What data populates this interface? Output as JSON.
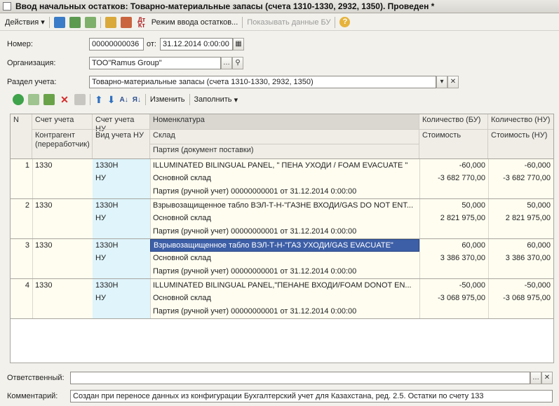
{
  "window": {
    "title": "Ввод начальных остатков: Товарно-материальные запасы (счета 1310-1330, 2932, 1350). Проведен *"
  },
  "toolbar": {
    "actions_label": "Действия",
    "mode_label": "Режим ввода остатков...",
    "show_bu_label": "Показывать данные БУ",
    "help_label": "?"
  },
  "header": {
    "number_label": "Номер:",
    "number_value": "00000000036",
    "date_label": "от:",
    "date_value": "31.12.2014 0:00:00",
    "org_label": "Организация:",
    "org_value": "ТОО\"Ramus Group\"",
    "section_label": "Раздел учета:",
    "section_value": "Товарно-материальные запасы (счета 1310-1330, 2932, 1350)"
  },
  "table_toolbar": {
    "edit_label": "Изменить",
    "fill_label": "Заполнить"
  },
  "table": {
    "headers": {
      "n": "N",
      "account": "Счет учета",
      "account_nu": "Счет учета НУ",
      "nomenclature": "Номенклатура",
      "qty_bu": "Количество (БУ)",
      "qty_nu": "Количество (НУ)",
      "contractor": "Контрагент (переработчик)",
      "type_nu": "Вид учета НУ",
      "warehouse": "Склад",
      "batch": "Партия (документ поставки)",
      "cost_bu": "Стоимость",
      "cost_nu": "Стоимость (НУ)"
    },
    "rows": [
      {
        "n": "1",
        "account": "1330",
        "account_nu": "1330Н",
        "type_nu": "НУ",
        "nomenclature": "ILLUMINATED BILINGUAL PANEL, \" ПЕНА УХОДИ / FOAM EVACUATE \"",
        "warehouse": "Основной склад",
        "batch": "Партия (ручной учет) 00000000001 от 31.12.2014 0:00:00",
        "qty_bu": "-60,000",
        "cost_bu": "-3 682 770,00",
        "qty_nu": "-60,000",
        "cost_nu": "-3 682 770,00"
      },
      {
        "n": "2",
        "account": "1330",
        "account_nu": "1330Н",
        "type_nu": "НУ",
        "nomenclature": "Взрывозащищенное табло ВЭЛ-Т-Н-\"ГАЗНЕ ВХОДИ/GAS DO NOT ENT...",
        "warehouse": "Основной склад",
        "batch": "Партия (ручной учет) 00000000001 от 31.12.2014 0:00:00",
        "qty_bu": "50,000",
        "cost_bu": "2 821 975,00",
        "qty_nu": "50,000",
        "cost_nu": "2 821 975,00"
      },
      {
        "n": "3",
        "account": "1330",
        "account_nu": "1330Н",
        "type_nu": "НУ",
        "nomenclature": "Взрывозащищенное табло ВЭЛ-Т-Н-\"ГАЗ УХОДИ/GAS EVACUATE\"",
        "warehouse": "Основной склад",
        "batch": "Партия (ручной учет) 00000000001 от 31.12.2014 0:00:00",
        "qty_bu": "60,000",
        "cost_bu": "3 386 370,00",
        "qty_nu": "60,000",
        "cost_nu": "3 386 370,00"
      },
      {
        "n": "4",
        "account": "1330",
        "account_nu": "1330Н",
        "type_nu": "НУ",
        "nomenclature": "ILLUMINATED BILINGUAL PANEL,\"ПЕНАНЕ ВХОДИ/FOAM DONOT EN...",
        "warehouse": "Основной склад",
        "batch": "Партия (ручной учет) 00000000001 от 31.12.2014 0:00:00",
        "qty_bu": "-50,000",
        "cost_bu": "-3 068 975,00",
        "qty_nu": "-50,000",
        "cost_nu": "-3 068 975,00"
      }
    ]
  },
  "footer": {
    "responsible_label": "Ответственный:",
    "responsible_value": "",
    "comment_label": "Комментарий:",
    "comment_value": "Создан при переносе данных из конфигурации Бухгалтерский учет для Казахстана, ред. 2.5. Остатки по счету 133"
  }
}
